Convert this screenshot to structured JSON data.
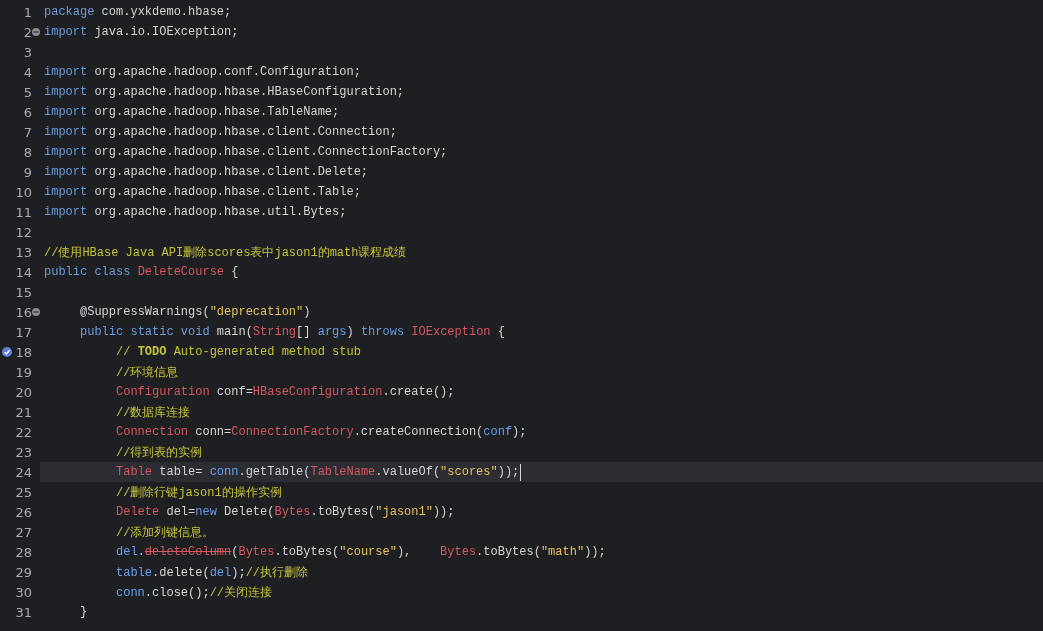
{
  "editor": {
    "lines": [
      {
        "number": "1",
        "current": false,
        "kind": "plain",
        "tokens": [
          {
            "kind": "keyword",
            "text": "package"
          },
          {
            "kind": "plain",
            "text": " com.yxkdemo.hbase;"
          }
        ]
      },
      {
        "number": "2",
        "current": false,
        "kind": "fold",
        "tokens": [
          {
            "kind": "keyword",
            "text": "import"
          },
          {
            "kind": "plain",
            "text": " java.io.IOException;"
          }
        ]
      },
      {
        "number": "3",
        "current": false,
        "kind": "plain"
      },
      {
        "number": "4",
        "current": false,
        "kind": "plain",
        "tokens": [
          {
            "kind": "keyword",
            "text": "import"
          },
          {
            "kind": "plain",
            "text": " org.apache.hadoop.conf.Configuration;"
          }
        ]
      },
      {
        "number": "5",
        "current": false,
        "kind": "plain",
        "tokens": [
          {
            "kind": "keyword",
            "text": "import"
          },
          {
            "kind": "plain",
            "text": " org.apache.hadoop.hbase.HBaseConfiguration;"
          }
        ]
      },
      {
        "number": "6",
        "current": false,
        "kind": "plain",
        "tokens": [
          {
            "kind": "keyword",
            "text": "import"
          },
          {
            "kind": "plain",
            "text": " org.apache.hadoop.hbase.TableName;"
          }
        ]
      },
      {
        "number": "7",
        "current": false,
        "kind": "plain",
        "tokens": [
          {
            "kind": "keyword",
            "text": "import"
          },
          {
            "kind": "plain",
            "text": " org.apache.hadoop.hbase.client.Connection;"
          }
        ]
      },
      {
        "number": "8",
        "current": false,
        "kind": "plain",
        "tokens": [
          {
            "kind": "keyword",
            "text": "import"
          },
          {
            "kind": "plain",
            "text": " org.apache.hadoop.hbase.client.ConnectionFactory;"
          }
        ]
      },
      {
        "number": "9",
        "current": false,
        "kind": "plain",
        "tokens": [
          {
            "kind": "keyword",
            "text": "import"
          },
          {
            "kind": "plain",
            "text": " org.apache.hadoop.hbase.client.Delete;"
          }
        ]
      },
      {
        "number": "10",
        "current": false,
        "kind": "plain",
        "tokens": [
          {
            "kind": "keyword",
            "text": "import"
          },
          {
            "kind": "plain",
            "text": " org.apache.hadoop.hbase.client.Table;"
          }
        ]
      },
      {
        "number": "11",
        "current": false,
        "kind": "plain",
        "tokens": [
          {
            "kind": "keyword",
            "text": "import"
          },
          {
            "kind": "plain",
            "text": " org.apache.hadoop.hbase.util.Bytes;"
          }
        ]
      },
      {
        "number": "12",
        "current": false,
        "kind": "plain"
      },
      {
        "number": "13",
        "current": false,
        "kind": "plain",
        "tokens": [
          {
            "kind": "comment",
            "text": "//使用HBase Java API删除scores表中jason1的math课程成绩"
          }
        ]
      },
      {
        "number": "14",
        "current": false,
        "kind": "plain",
        "tokens": [
          {
            "kind": "keyword",
            "text": "public class "
          },
          {
            "kind": "type",
            "text": "DeleteCourse"
          },
          {
            "kind": "plain",
            "text": " {"
          }
        ]
      },
      {
        "number": "15",
        "current": false,
        "kind": "plain"
      },
      {
        "number": "16",
        "current": false,
        "kind": "fold",
        "tokens": [
          {
            "kind": "plain",
            "text": "\t@SuppressWarnings("
          },
          {
            "kind": "string",
            "text": "\"deprecation\""
          },
          {
            "kind": "plain",
            "text": ")"
          }
        ]
      },
      {
        "number": "17",
        "current": false,
        "kind": "plain",
        "tokens": [
          {
            "kind": "keyword",
            "text": "\tpublic static void "
          },
          {
            "kind": "plain",
            "text": "main("
          },
          {
            "kind": "type",
            "text": "String"
          },
          {
            "kind": "plain",
            "text": "[] "
          },
          {
            "kind": "variable",
            "text": "args"
          },
          {
            "kind": "plain",
            "text": ") "
          },
          {
            "kind": "keyword",
            "text": "throws "
          },
          {
            "kind": "type",
            "text": "IOException"
          },
          {
            "kind": "plain",
            "text": " {"
          }
        ]
      },
      {
        "number": "18",
        "current": false,
        "kind": "task",
        "tokens": [
          {
            "kind": "comment",
            "text": "\t\t// "
          },
          {
            "kind": "todo",
            "text": "TODO"
          },
          {
            "kind": "comment",
            "text": " Auto-generated method stub"
          }
        ]
      },
      {
        "number": "19",
        "current": false,
        "kind": "plain",
        "tokens": [
          {
            "kind": "comment",
            "text": "\t\t//环境信息"
          }
        ]
      },
      {
        "number": "20",
        "current": false,
        "kind": "plain",
        "tokens": [
          {
            "kind": "type",
            "text": "\t\tConfiguration"
          },
          {
            "kind": "plain",
            "text": " conf="
          },
          {
            "kind": "type",
            "text": "HBaseConfiguration"
          },
          {
            "kind": "plain",
            "text": ".create();"
          }
        ]
      },
      {
        "number": "21",
        "current": false,
        "kind": "plain",
        "tokens": [
          {
            "kind": "comment",
            "text": "\t\t//数据库连接"
          }
        ]
      },
      {
        "number": "22",
        "current": false,
        "kind": "plain",
        "tokens": [
          {
            "kind": "type",
            "text": "\t\tConnection"
          },
          {
            "kind": "plain",
            "text": " conn="
          },
          {
            "kind": "type",
            "text": "ConnectionFactory"
          },
          {
            "kind": "plain",
            "text": ".createConnection("
          },
          {
            "kind": "variable",
            "text": "conf"
          },
          {
            "kind": "plain",
            "text": ");"
          }
        ]
      },
      {
        "number": "23",
        "current": false,
        "kind": "plain",
        "tokens": [
          {
            "kind": "comment",
            "text": "\t\t//得到表的实例"
          }
        ]
      },
      {
        "number": "24",
        "current": true,
        "kind": "plain",
        "tokens": [
          {
            "kind": "type",
            "text": "\t\tTable"
          },
          {
            "kind": "plain",
            "text": " table= "
          },
          {
            "kind": "variable",
            "text": "conn"
          },
          {
            "kind": "plain",
            "text": ".getTable("
          },
          {
            "kind": "type",
            "text": "TableName"
          },
          {
            "kind": "plain",
            "text": ".valueOf("
          },
          {
            "kind": "string",
            "text": "\"scores\""
          },
          {
            "kind": "plain",
            "text": "));"
          }
        ]
      },
      {
        "number": "25",
        "current": false,
        "kind": "plain",
        "tokens": [
          {
            "kind": "comment",
            "text": "\t\t//删除行键jason1的操作实例"
          }
        ]
      },
      {
        "number": "26",
        "current": false,
        "kind": "plain",
        "tokens": [
          {
            "kind": "type",
            "text": "\t\tDelete"
          },
          {
            "kind": "plain",
            "text": " del="
          },
          {
            "kind": "keyword",
            "text": "new"
          },
          {
            "kind": "plain",
            "text": " Delete("
          },
          {
            "kind": "type",
            "text": "Bytes"
          },
          {
            "kind": "plain",
            "text": ".toBytes("
          },
          {
            "kind": "string",
            "text": "\"jason1\""
          },
          {
            "kind": "plain",
            "text": "));"
          }
        ]
      },
      {
        "number": "27",
        "current": false,
        "kind": "plain",
        "tokens": [
          {
            "kind": "comment",
            "text": "\t\t//添加列键信息。"
          }
        ]
      },
      {
        "number": "28",
        "current": false,
        "kind": "plain",
        "tokens": [
          {
            "kind": "variable",
            "text": "\t\tdel"
          },
          {
            "kind": "plain",
            "text": "."
          },
          {
            "kind": "deprecated",
            "text": "deleteColumn"
          },
          {
            "kind": "plain",
            "text": "("
          },
          {
            "kind": "type",
            "text": "Bytes"
          },
          {
            "kind": "plain",
            "text": ".toBytes("
          },
          {
            "kind": "string",
            "text": "\"course\""
          },
          {
            "kind": "plain",
            "text": "),\t"
          },
          {
            "kind": "type",
            "text": "Bytes"
          },
          {
            "kind": "plain",
            "text": ".toBytes("
          },
          {
            "kind": "string",
            "text": "\"math\""
          },
          {
            "kind": "plain",
            "text": "));"
          }
        ]
      },
      {
        "number": "29",
        "current": false,
        "kind": "plain",
        "tokens": [
          {
            "kind": "variable",
            "text": "\t\ttable"
          },
          {
            "kind": "plain",
            "text": ".delete("
          },
          {
            "kind": "variable",
            "text": "del"
          },
          {
            "kind": "plain",
            "text": ");"
          },
          {
            "kind": "comment",
            "text": "//执行删除"
          }
        ]
      },
      {
        "number": "30",
        "current": false,
        "kind": "plain",
        "tokens": [
          {
            "kind": "variable",
            "text": "\t\tconn"
          },
          {
            "kind": "plain",
            "text": ".close();"
          },
          {
            "kind": "comment",
            "text": "//关闭连接"
          }
        ]
      },
      {
        "number": "31",
        "current": false,
        "kind": "plain",
        "tokens": [
          {
            "kind": "plain",
            "text": "\t}"
          }
        ]
      }
    ]
  }
}
